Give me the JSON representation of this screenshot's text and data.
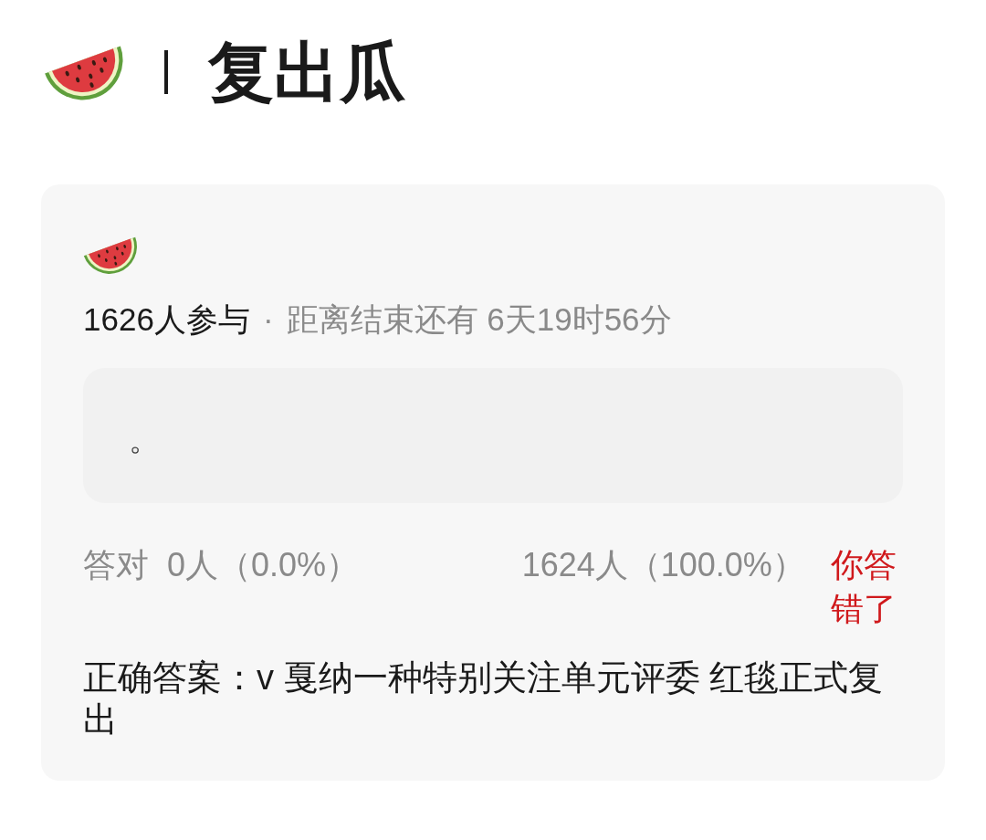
{
  "header": {
    "title": "复出瓜"
  },
  "card": {
    "meta": {
      "participants": "1626人参与",
      "separator": "·",
      "countdown": "距离结束还有 6天19时56分"
    },
    "answer_box": {
      "text": "。"
    },
    "stats": {
      "correct_label": "答对",
      "correct_count": "0人（0.0%）",
      "wrong_count": "1624人（100.0%）",
      "result": {
        "text": "你答错了",
        "correct": false
      }
    },
    "correct_answer": "正确答案：v 戛纳一种特别关注单元评委 红毯正式复出"
  }
}
